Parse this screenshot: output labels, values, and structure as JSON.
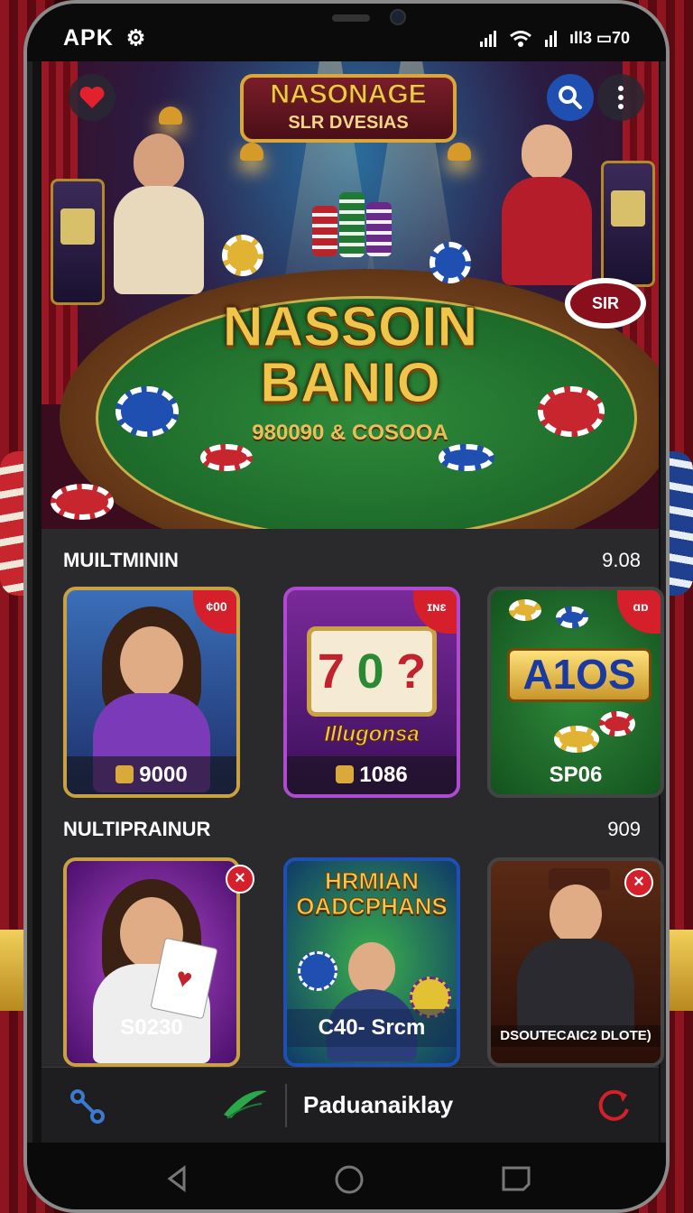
{
  "status_bar": {
    "left_text": "APK",
    "gear_glyph": "⚙",
    "right_text": "ıll3 ▭70"
  },
  "hero": {
    "banner_line1": "NASONAGE",
    "banner_line2": "SLR DVESIAS",
    "title_line1": "NASSOIN",
    "title_line2": "BANIO",
    "subtitle": "980090 & COSOOA",
    "corner_chip_text": "SIR"
  },
  "section1": {
    "title": "MUILTMININ",
    "count": "9.08",
    "cards": [
      {
        "label": "9000",
        "badge": "¢00",
        "has_coin": true
      },
      {
        "label": "1086",
        "badge": "ɪɴɛ",
        "has_coin": true,
        "reel_text": [
          "7",
          "0",
          "?"
        ],
        "sub_text": "Illugonsa"
      },
      {
        "label": "SP06",
        "badge": "ɑɒ",
        "has_coin": false,
        "logo_text": "A1OS"
      }
    ]
  },
  "section2": {
    "title": "NULTIPRAINUR",
    "count": "909",
    "cards": [
      {
        "label": "S0230"
      },
      {
        "label": "C40- Srcm",
        "promo_title": "HRMIAN OADCPHANS"
      },
      {
        "label": "DSOUTECAIC2 DLOTE)"
      }
    ]
  },
  "bottom_bar": {
    "brand": "Paduanaiklay"
  },
  "colors": {
    "accent_gold": "#c9a042",
    "badge_red": "#d5202b",
    "search_blue": "#1f4fb0",
    "panel_bg": "#2a2a2d"
  }
}
